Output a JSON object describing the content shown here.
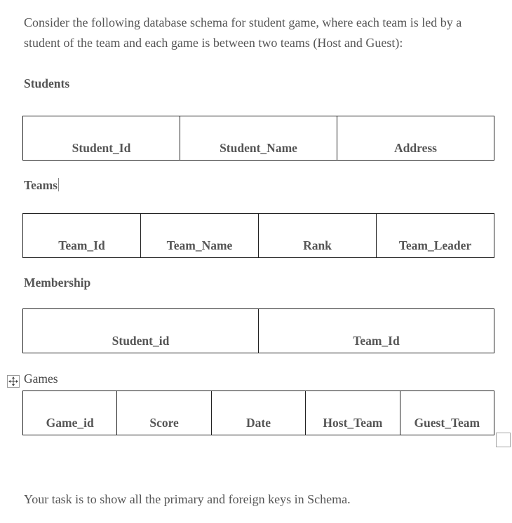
{
  "intro_text": "Consider the following database schema for student game, where each team is led by a student of the team and each game is between two teams (Host and Guest):",
  "tables": {
    "students": {
      "title": "Students",
      "columns": [
        "Student_Id",
        "Student_Name",
        "Address"
      ]
    },
    "teams": {
      "title": "Teams",
      "columns": [
        "Team_Id",
        "Team_Name",
        "Rank",
        "Team_Leader"
      ]
    },
    "membership": {
      "title": "Membership",
      "columns": [
        "Student_id",
        "Team_Id"
      ]
    },
    "games": {
      "title": "Games",
      "columns": [
        "Game_id",
        "Score",
        "Date",
        "Host_Team",
        "Guest_Team"
      ]
    }
  },
  "icons": {
    "table_move_handle": "move-arrows-icon",
    "table_resize_handle": "resize-square-icon"
  },
  "task_text": "Your task is to show all the primary and foreign keys in Schema."
}
